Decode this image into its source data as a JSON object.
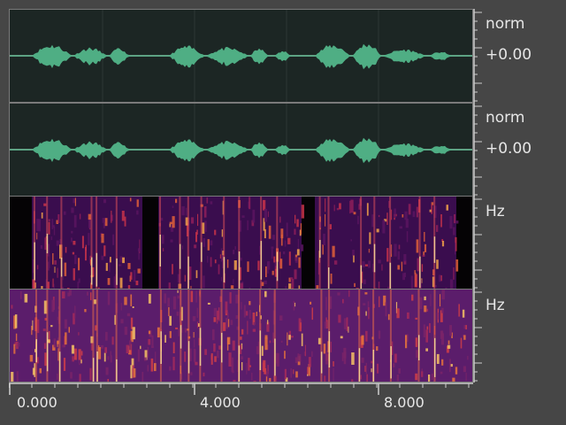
{
  "tracks": [
    {
      "type": "waveform",
      "scale_label": "norm",
      "value_label": "+0.00"
    },
    {
      "type": "waveform",
      "scale_label": "norm",
      "value_label": "+0.00"
    },
    {
      "type": "spectrogram",
      "scale_label": "Hz",
      "style": "dark"
    },
    {
      "type": "spectrogram",
      "scale_label": "Hz",
      "style": "magenta"
    }
  ],
  "timeline": {
    "tick_labels": [
      "0.000",
      "4.000",
      "8.000"
    ]
  },
  "colors": {
    "background": "#464646",
    "waveform_fill": "#4fae84",
    "waveform_bg": "#1c2624"
  }
}
